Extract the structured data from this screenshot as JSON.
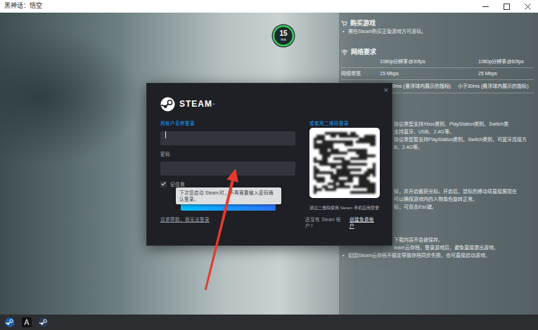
{
  "window": {
    "title": "黑神话：悟空"
  },
  "ping": {
    "value": "15",
    "unit": "ms",
    "level": 1
  },
  "info": {
    "purchase": {
      "title": "购买游戏",
      "lines": [
        {
          "kind": "bullet",
          "bullet": "•",
          "text": "需在Steam购买正版游戏方可游玩。"
        }
      ]
    },
    "network": {
      "title": "网络要求",
      "columns": [
        "1080p分辨率@30fps",
        "1080p分辨率@60fps"
      ],
      "rows": [
        {
          "label": "网络带宽",
          "values": [
            "15 Mbps",
            "25 Mbps"
          ]
        }
      ],
      "partial_row": [
        "0ms (悬浮球内展示的指标)",
        "小于30ms (悬浮球内展示的指标)"
      ]
    },
    "notes": [
      {
        "lines": [
          {
            "kind": "clipped",
            "text": "协议类型支持Xbox类别、PlayStation类别、Switch类"
          },
          {
            "kind": "clipped",
            "text": "支持蓝牙、USB、2.4G等。"
          },
          {
            "kind": "clipped",
            "text": "协议类型暂支持PlayStation类别、Switch类别，可蓝牙连接方"
          },
          {
            "kind": "clipped",
            "text": "B、2.4G等。"
          }
        ]
      },
      {
        "lines": [
          {
            "kind": "clipped",
            "text": "标，并开启截获光标。开启后，鼠标的移动将直接展现在"
          },
          {
            "kind": "clipped",
            "text": "可以确保游戏内的人物角色旋转正常。"
          },
          {
            "kind": "clipped",
            "text": "标，可双击Esc键。"
          }
        ]
      },
      {
        "lines": [
          {
            "kind": "clipped",
            "text": "下载内容不会被保存。"
          },
          {
            "kind": "clipped",
            "text": "team云存档，登录游戏后，避免直接退出游戏。"
          },
          {
            "kind": "bullet",
            "bullet": "•",
            "text": "如因Steam云存档不稳定导致存档同步失败，也可直接启动游戏。"
          }
        ]
      }
    ]
  },
  "login": {
    "close": "×",
    "brand": "STEAM",
    "brand_mark": "®",
    "account": {
      "label": "用帐户名称登录",
      "focused": true
    },
    "password": {
      "label": "密码"
    },
    "remember": {
      "label": "记住我",
      "checked": true
    },
    "tooltip": "下次您启动 Steam 时，不再需要输入密码确认登录。",
    "qr": {
      "label": "或者用二维码登录",
      "caption": "通过二维码使用 Steam 手机应用登录"
    },
    "help": "请求帮助，我无法登录",
    "signup": {
      "prompt": "还没有 Steam 帐户?",
      "link": "创建免费帐户"
    }
  }
}
